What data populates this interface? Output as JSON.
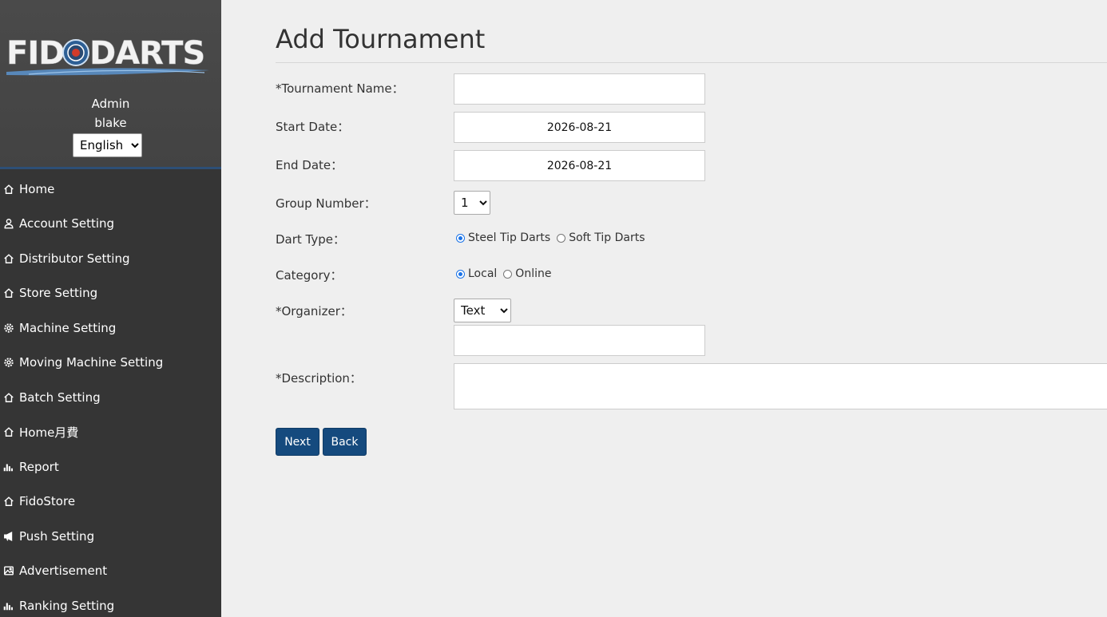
{
  "brand": {
    "logo_text": "FIDODARTS"
  },
  "user": {
    "role": "Admin",
    "name": "blake"
  },
  "language": {
    "selected": "English"
  },
  "nav": [
    {
      "icon": "home-icon",
      "label": "Home"
    },
    {
      "icon": "user-icon",
      "label": "Account Setting"
    },
    {
      "icon": "home-icon",
      "label": "Distributor Setting"
    },
    {
      "icon": "home-icon",
      "label": "Store Setting"
    },
    {
      "icon": "gear-icon",
      "label": "Machine Setting"
    },
    {
      "icon": "gear-icon",
      "label": "Moving Machine Setting"
    },
    {
      "icon": "home-icon",
      "label": "Batch Setting"
    },
    {
      "icon": "home-icon",
      "label": "Home月費"
    },
    {
      "icon": "bar-chart-icon",
      "label": "Report"
    },
    {
      "icon": "home-icon",
      "label": "FidoStore"
    },
    {
      "icon": "megaphone-icon",
      "label": "Push Setting"
    },
    {
      "icon": "image-icon",
      "label": "Advertisement"
    },
    {
      "icon": "bar-chart-icon",
      "label": "Ranking Setting"
    }
  ],
  "form": {
    "title": "Add Tournament",
    "tournament_name": {
      "label": "*Tournament Name：",
      "value": ""
    },
    "start_date": {
      "label": "Start Date：",
      "value": "2026-08-21"
    },
    "end_date": {
      "label": "End Date：",
      "value": "2026-08-21"
    },
    "group_number": {
      "label": "Group Number：",
      "selected": "1"
    },
    "dart_type": {
      "label": "Dart Type：",
      "options": [
        "Steel Tip Darts",
        "Soft Tip Darts"
      ],
      "selected": "Steel Tip Darts"
    },
    "category": {
      "label": "Category：",
      "options": [
        "Local",
        "Online"
      ],
      "selected": "Local"
    },
    "organizer": {
      "label": "*Organizer：",
      "type_selected": "Text",
      "value": ""
    },
    "description": {
      "label": "*Description：",
      "value": ""
    },
    "next_label": "Next",
    "back_label": "Back"
  }
}
